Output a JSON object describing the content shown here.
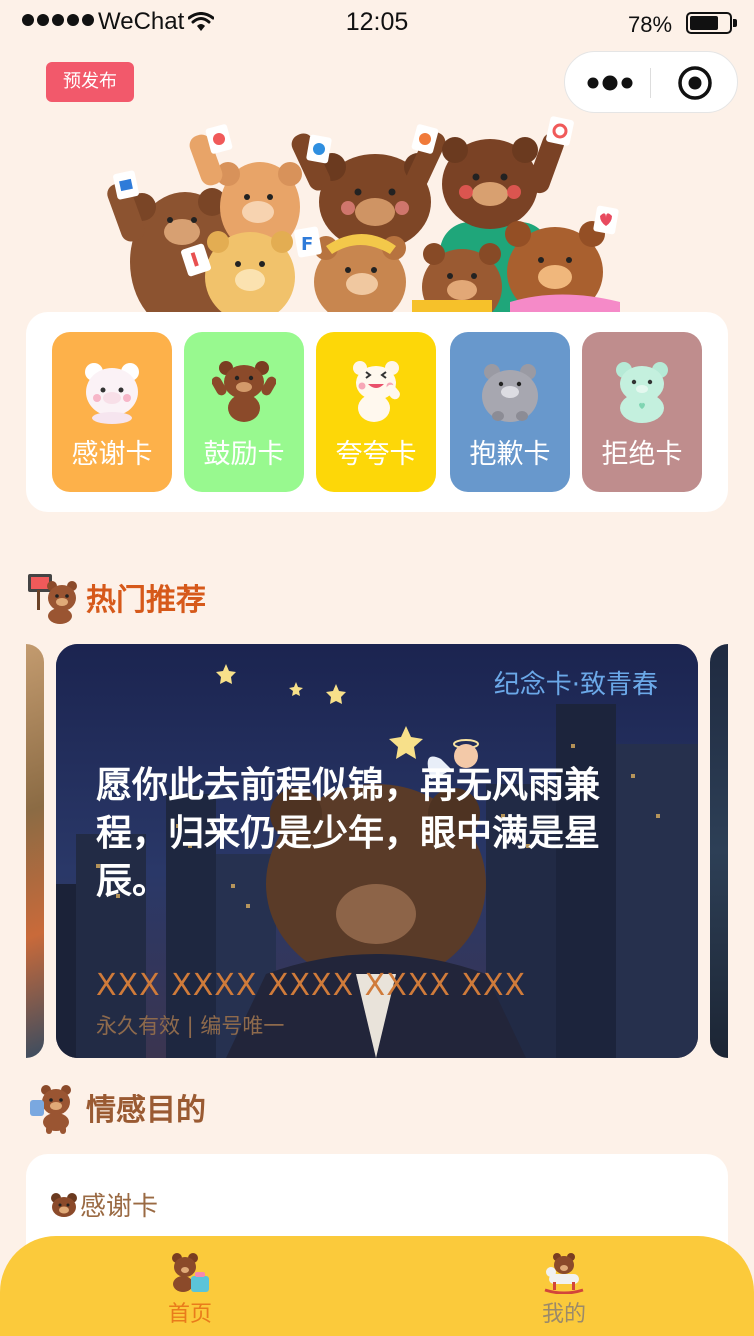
{
  "status_bar": {
    "carrier": "WeChat",
    "time": "12:05",
    "battery": "78%",
    "battery_level": 0.78
  },
  "badge": {
    "label": "预发布"
  },
  "categories": [
    {
      "label": "感谢卡",
      "color": "#fdb14a"
    },
    {
      "label": "鼓励卡",
      "color": "#98f98f"
    },
    {
      "label": "夸夸卡",
      "color": "#fdd708"
    },
    {
      "label": "抱歉卡",
      "color": "#6898cc"
    },
    {
      "label": "拒绝卡",
      "color": "#bf8d8d"
    }
  ],
  "hot_section": {
    "title": "热门推荐",
    "title_color": "#d6591a"
  },
  "hot_card": {
    "tag": "纪念卡·致青春",
    "quote": "愿你此去前程似锦，再无风雨兼程，归来仍是少年，眼中满是星辰。",
    "code": "XXX XXXX XXXX XXXX XXX",
    "validity": "永久有效 | 编号唯一"
  },
  "emotion_section": {
    "title": "情感目的",
    "title_color": "#9a5a32",
    "items": [
      {
        "label": "感谢卡"
      }
    ]
  },
  "tabbar": {
    "tabs": [
      {
        "label": "首页",
        "active": true,
        "color": "#e97b1b"
      },
      {
        "label": "我的",
        "active": false,
        "color": "#9b8a6a"
      }
    ]
  }
}
